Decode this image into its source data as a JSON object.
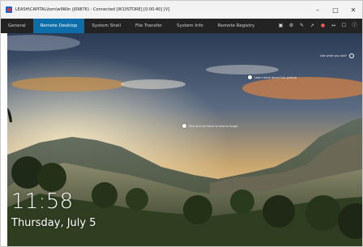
{
  "window": {
    "title": "LEASH\\CAPITAL\\tom\\w9Win (J09876) - Connected [W10STORE] [0:00:40] [V]",
    "controls": [
      "minimize-icon",
      "maximize-icon",
      "close-icon"
    ]
  },
  "tabs": [
    {
      "label": "General",
      "active": false
    },
    {
      "label": "Remote Desktop",
      "active": true
    },
    {
      "label": "System Shell",
      "active": false
    },
    {
      "label": "File Transfer",
      "active": false
    },
    {
      "label": "System Info",
      "active": false
    },
    {
      "label": "Remote Registry",
      "active": false
    }
  ],
  "toolbar": {
    "icons": [
      "monitor-icon",
      "settings-icon",
      "pen-icon",
      "pointer-icon",
      "record-icon",
      "resize-icon",
      "fullscreen-icon",
      "info-icon"
    ],
    "accent_record": "#ff5a50"
  },
  "remote": {
    "hotspot_top_right": "Like what you see?",
    "hotspot_a": "Learn more about this picture",
    "hotspot_b": "This kind of travel is hard to forget",
    "time": "11:58",
    "date": "Thursday, July 5"
  },
  "colors": {
    "tab_active": "#0d6da8",
    "tabbar_bg": "#232323",
    "titlebar_bg": "#f3f3f3"
  }
}
